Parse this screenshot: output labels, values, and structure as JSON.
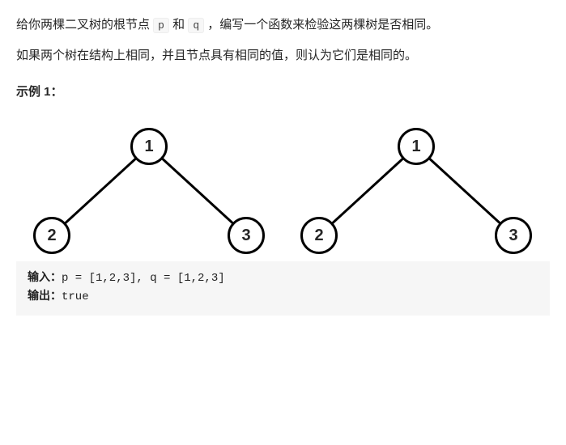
{
  "desc": {
    "p1_a": "给你两棵二叉树的根节点 ",
    "code_p": "p",
    "p1_b": " 和 ",
    "code_q": "q",
    "p1_c": " ，编写一个函数来检验这两棵树是否相同。",
    "p2": "如果两个树在结构上相同，并且节点具有相同的值，则认为它们是相同的。"
  },
  "example": {
    "label": "示例 1：",
    "tree1": {
      "root": "1",
      "left": "2",
      "right": "3"
    },
    "tree2": {
      "root": "1",
      "left": "2",
      "right": "3"
    },
    "input_label": "输入：",
    "input_value": "p = [1,2,3], q = [1,2,3]",
    "output_label": "输出：",
    "output_value": "true"
  }
}
